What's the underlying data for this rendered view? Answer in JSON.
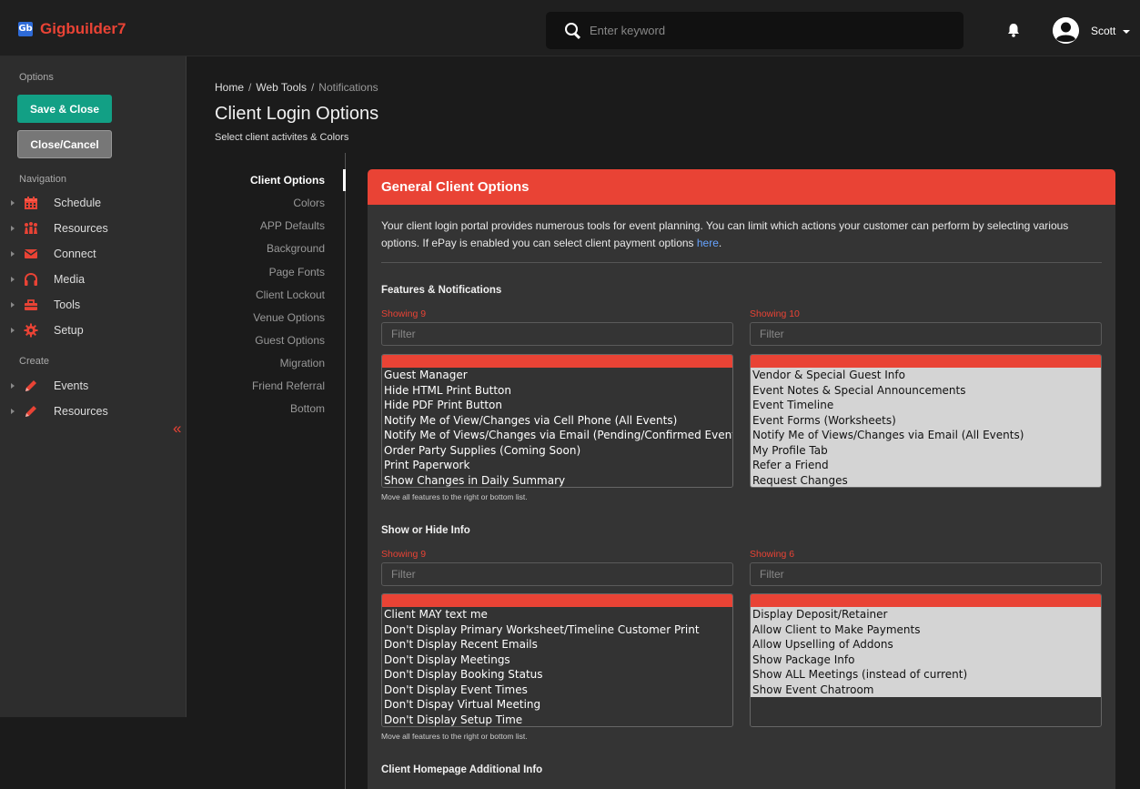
{
  "brand": {
    "logo_text": "Gb",
    "name": "Gigbuilder7"
  },
  "header": {
    "search_placeholder": "Enter keyword",
    "user_name": "Scott"
  },
  "sidebar": {
    "options_label": "Options",
    "save_close": "Save & Close",
    "close_cancel": "Close/Cancel",
    "navigation_label": "Navigation",
    "nav_items": [
      "Schedule",
      "Resources",
      "Connect",
      "Media",
      "Tools",
      "Setup"
    ],
    "create_label": "Create",
    "create_items": [
      "Events",
      "Resources"
    ],
    "collapse_icon": "«"
  },
  "breadcrumb": {
    "home": "Home",
    "web_tools": "Web Tools",
    "current": "Notifications",
    "sep": "/"
  },
  "page": {
    "title": "Client Login Options",
    "subtitle": "Select client activites & Colors"
  },
  "tabs": [
    "Client Options",
    "Colors",
    "APP Defaults",
    "Background",
    "Page Fonts",
    "Client Lockout",
    "Venue Options",
    "Guest Options",
    "Migration",
    "Friend Referral",
    "Bottom"
  ],
  "panel": {
    "title": "General Client Options",
    "intro": "Your client login portal provides numerous tools for event planning. You can limit which actions your customer can perform by selecting various options. If ePay is enabled you can select client payment options ",
    "intro_link": "here",
    "intro_end": ".",
    "sections": [
      {
        "title": "Features & Notifications",
        "left": {
          "showing": "Showing 9",
          "filter_placeholder": "Filter",
          "items": [
            "Guest Manager",
            "Hide HTML Print Button",
            "Hide PDF Print Button",
            "Notify Me of View/Changes via Cell Phone (All Events)",
            "Notify Me of Views/Changes via Email (Pending/Confirmed Events)",
            "Order Party Supplies (Coming Soon)",
            "Print Paperwork",
            "Show Changes in Daily Summary"
          ]
        },
        "right": {
          "showing": "Showing 10",
          "filter_placeholder": "Filter",
          "items": [
            "Vendor & Special Guest Info",
            "Event Notes & Special Announcements",
            "Event Timeline",
            "Event Forms (Worksheets)",
            "Notify Me of Views/Changes via Email (All Events)",
            "My Profile Tab",
            "Refer a Friend",
            "Request Changes"
          ]
        },
        "hint": "Move all features to the right or bottom list."
      },
      {
        "title": "Show or Hide Info",
        "left": {
          "showing": "Showing 9",
          "filter_placeholder": "Filter",
          "items": [
            "Client MAY text me",
            "Don't Display Primary Worksheet/Timeline Customer Print",
            "Don't Display Recent Emails",
            "Don't Display Meetings",
            "Don't Display Booking Status",
            "Don't Display Event Times",
            "Don't Dispay Virtual Meeting",
            "Don't Display Setup Time"
          ]
        },
        "right": {
          "showing": "Showing 6",
          "filter_placeholder": "Filter",
          "items": [
            "Display Deposit/Retainer",
            "Allow Client to Make Payments",
            "Allow Upselling of Addons",
            "Show Package Info",
            "Show ALL Meetings (instead of current)",
            "Show Event Chatroom"
          ]
        },
        "hint": "Move all features to the right or bottom list."
      },
      {
        "title": "Client Homepage Additional Info"
      }
    ]
  },
  "colors": {
    "accent": "#e94335",
    "save": "#12a085",
    "link": "#66a3ff"
  }
}
